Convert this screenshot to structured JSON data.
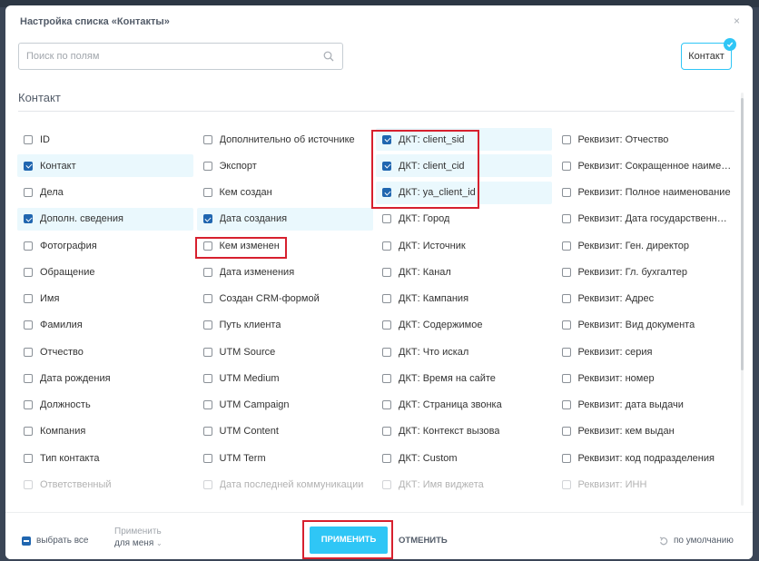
{
  "dialog": {
    "title": "Настройка списка «Контакты»",
    "close": "×"
  },
  "search": {
    "placeholder": "Поиск по полям"
  },
  "entity_button": {
    "label": "Контакт"
  },
  "section": {
    "title": "Контакт"
  },
  "columns": [
    [
      {
        "label": "ID",
        "checked": false
      },
      {
        "label": "Контакт",
        "checked": true
      },
      {
        "label": "Дела",
        "checked": false
      },
      {
        "label": "Дополн. сведения",
        "checked": true
      },
      {
        "label": "Фотография",
        "checked": false
      },
      {
        "label": "Обращение",
        "checked": false
      },
      {
        "label": "Имя",
        "checked": false
      },
      {
        "label": "Фамилия",
        "checked": false
      },
      {
        "label": "Отчество",
        "checked": false
      },
      {
        "label": "Дата рождения",
        "checked": false
      },
      {
        "label": "Должность",
        "checked": false
      },
      {
        "label": "Компания",
        "checked": false
      },
      {
        "label": "Тип контакта",
        "checked": false
      },
      {
        "label": "Ответственный",
        "checked": false,
        "faded": true
      }
    ],
    [
      {
        "label": "Дополнительно об источнике",
        "checked": false
      },
      {
        "label": "Экспорт",
        "checked": false
      },
      {
        "label": "Кем создан",
        "checked": false
      },
      {
        "label": "Дата создания",
        "checked": true
      },
      {
        "label": "Кем изменен",
        "checked": false
      },
      {
        "label": "Дата изменения",
        "checked": false
      },
      {
        "label": "Создан CRM-формой",
        "checked": false
      },
      {
        "label": "Путь клиента",
        "checked": false
      },
      {
        "label": "UTM Source",
        "checked": false
      },
      {
        "label": "UTM Medium",
        "checked": false
      },
      {
        "label": "UTM Campaign",
        "checked": false
      },
      {
        "label": "UTM Content",
        "checked": false
      },
      {
        "label": "UTM Term",
        "checked": false
      },
      {
        "label": "Дата последней коммуникации",
        "checked": false,
        "faded": true
      }
    ],
    [
      {
        "label": "ДКТ: client_sid",
        "checked": true
      },
      {
        "label": "ДКТ: client_cid",
        "checked": true
      },
      {
        "label": "ДКТ: ya_client_id",
        "checked": true
      },
      {
        "label": "ДКТ: Город",
        "checked": false
      },
      {
        "label": "ДКТ: Источник",
        "checked": false
      },
      {
        "label": "ДКТ: Канал",
        "checked": false
      },
      {
        "label": "ДКТ: Кампания",
        "checked": false
      },
      {
        "label": "ДКТ: Содержимое",
        "checked": false
      },
      {
        "label": "ДКТ: Что искал",
        "checked": false
      },
      {
        "label": "ДКТ: Время на сайте",
        "checked": false
      },
      {
        "label": "ДКТ: Страница звонка",
        "checked": false
      },
      {
        "label": "ДКТ: Контекст вызова",
        "checked": false
      },
      {
        "label": "ДКТ: Custom",
        "checked": false
      },
      {
        "label": "ДКТ: Имя виджета",
        "checked": false,
        "faded": true
      }
    ],
    [
      {
        "label": "Реквизит: Отчество",
        "checked": false
      },
      {
        "label": "Реквизит: Сокращенное наименование",
        "checked": false
      },
      {
        "label": "Реквизит: Полное наименование",
        "checked": false
      },
      {
        "label": "Реквизит: Дата государственной регистрации",
        "checked": false
      },
      {
        "label": "Реквизит: Ген. директор",
        "checked": false
      },
      {
        "label": "Реквизит: Гл. бухгалтер",
        "checked": false
      },
      {
        "label": "Реквизит: Адрес",
        "checked": false
      },
      {
        "label": "Реквизит: Вид документа",
        "checked": false
      },
      {
        "label": "Реквизит: серия",
        "checked": false
      },
      {
        "label": "Реквизит: номер",
        "checked": false
      },
      {
        "label": "Реквизит: дата выдачи",
        "checked": false
      },
      {
        "label": "Реквизит: кем выдан",
        "checked": false
      },
      {
        "label": "Реквизит: код подразделения",
        "checked": false
      },
      {
        "label": "Реквизит: ИНН",
        "checked": false,
        "faded": true
      }
    ]
  ],
  "footer": {
    "select_all": "выбрать все",
    "apply_for_label": "Применить",
    "apply_for_value": "для меня",
    "apply": "ПРИМЕНИТЬ",
    "cancel": "ОТМЕНИТЬ",
    "reset": "по умолчанию"
  },
  "colors": {
    "accent": "#2fc6f6",
    "checkbox_checked": "#2066b0",
    "checked_row_bg": "#eaf8fd",
    "annotation_red": "#d7202e"
  }
}
